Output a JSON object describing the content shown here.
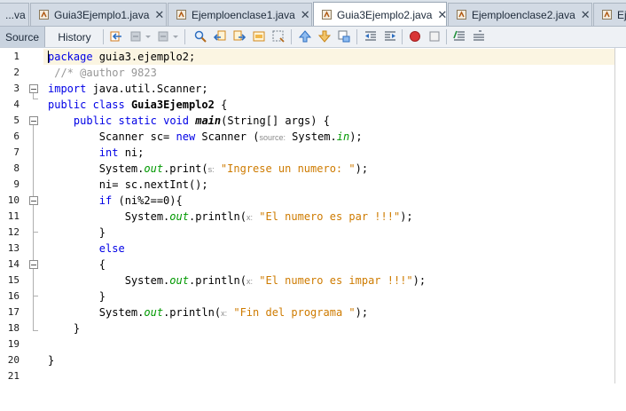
{
  "tabs": [
    {
      "label": "...va",
      "active": false,
      "close": false
    },
    {
      "label": "Guia3Ejemplo1.java",
      "active": false,
      "close": true
    },
    {
      "label": "Ejemploenclase1.java",
      "active": false,
      "close": true
    },
    {
      "label": "Guia3Ejemplo2.java",
      "active": true,
      "close": true
    },
    {
      "label": "Ejemploenclase2.java",
      "active": false,
      "close": true
    },
    {
      "label": "Eje",
      "active": false,
      "close": false
    }
  ],
  "toolbar": {
    "source_label": "Source",
    "history_label": "History"
  },
  "editor": {
    "line_numbers": [
      "1",
      "2",
      "3",
      "4",
      "5",
      "6",
      "7",
      "8",
      "9",
      "10",
      "11",
      "12",
      "13",
      "14",
      "15",
      "16",
      "17",
      "18",
      "19",
      "20",
      "21"
    ],
    "lines": [
      [
        {
          "t": "package",
          "c": "kw"
        },
        {
          "t": " guia3.ejemplo2;"
        }
      ],
      [
        {
          "t": " //* @author 9823",
          "c": "cm"
        }
      ],
      [
        {
          "t": "import",
          "c": "kw"
        },
        {
          "t": " java.util.Scanner;"
        }
      ],
      [
        {
          "t": "public",
          "c": "kw"
        },
        {
          "t": " "
        },
        {
          "t": "class",
          "c": "kw"
        },
        {
          "t": " "
        },
        {
          "t": "Guia3Ejemplo2",
          "c": "cls"
        },
        {
          "t": " {"
        }
      ],
      [
        {
          "t": "    "
        },
        {
          "t": "public",
          "c": "kw"
        },
        {
          "t": " "
        },
        {
          "t": "static",
          "c": "kw"
        },
        {
          "t": " "
        },
        {
          "t": "void",
          "c": "kw"
        },
        {
          "t": " "
        },
        {
          "t": "main",
          "c": "fnb"
        },
        {
          "t": "(String[] args) {"
        }
      ],
      [
        {
          "t": "        Scanner sc= "
        },
        {
          "t": "new",
          "c": "kw"
        },
        {
          "t": " Scanner ("
        },
        {
          "t": "source:",
          "c": "hint"
        },
        {
          "t": " System."
        },
        {
          "t": "in",
          "c": "fld"
        },
        {
          "t": ");"
        }
      ],
      [
        {
          "t": "        "
        },
        {
          "t": "int",
          "c": "kw"
        },
        {
          "t": " ni;"
        }
      ],
      [
        {
          "t": "        System."
        },
        {
          "t": "out",
          "c": "fld"
        },
        {
          "t": ".print("
        },
        {
          "t": "s:",
          "c": "hint"
        },
        {
          "t": " "
        },
        {
          "t": "\"Ingrese un numero: \"",
          "c": "str"
        },
        {
          "t": ");"
        }
      ],
      [
        {
          "t": "        ni= sc.nextInt();"
        }
      ],
      [
        {
          "t": "        "
        },
        {
          "t": "if",
          "c": "kw"
        },
        {
          "t": " (ni%2==0){"
        }
      ],
      [
        {
          "t": "            System."
        },
        {
          "t": "out",
          "c": "fld"
        },
        {
          "t": ".println("
        },
        {
          "t": "x:",
          "c": "hint"
        },
        {
          "t": " "
        },
        {
          "t": "\"El numero es par !!!\"",
          "c": "str"
        },
        {
          "t": ");"
        }
      ],
      [
        {
          "t": "        }"
        }
      ],
      [
        {
          "t": "        "
        },
        {
          "t": "else",
          "c": "kw"
        }
      ],
      [
        {
          "t": "        {"
        }
      ],
      [
        {
          "t": "            System."
        },
        {
          "t": "out",
          "c": "fld"
        },
        {
          "t": ".println("
        },
        {
          "t": "x:",
          "c": "hint"
        },
        {
          "t": " "
        },
        {
          "t": "\"El numero es impar !!!\"",
          "c": "str"
        },
        {
          "t": ");"
        }
      ],
      [
        {
          "t": "        }"
        }
      ],
      [
        {
          "t": "        System."
        },
        {
          "t": "out",
          "c": "fld"
        },
        {
          "t": ".println("
        },
        {
          "t": "x:",
          "c": "hint"
        },
        {
          "t": " "
        },
        {
          "t": "\"Fin del programa \"",
          "c": "str"
        },
        {
          "t": ");"
        }
      ],
      [
        {
          "t": "    }"
        }
      ],
      [],
      [
        {
          "t": "}"
        }
      ],
      []
    ]
  },
  "colors": {
    "keyword": "#0000e6",
    "string": "#ce7b00",
    "comment": "#969696",
    "static_field": "#009900",
    "current_line": "#fbf5e2"
  }
}
